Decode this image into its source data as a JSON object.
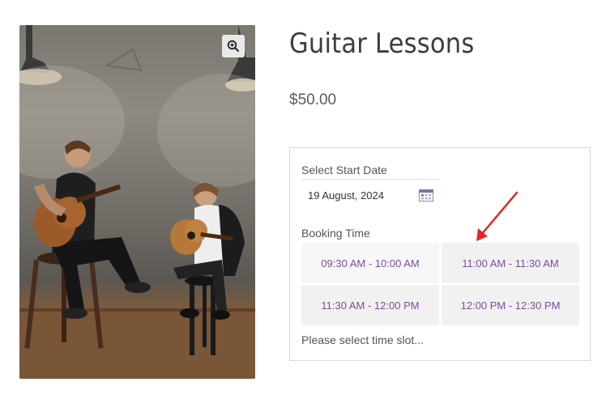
{
  "product": {
    "title": "Guitar Lessons",
    "price": "$50.00",
    "image_alt_icon": "zoom-in-icon"
  },
  "booking": {
    "start_date_label": "Select Start Date",
    "start_date_value": "19 August, 2024",
    "calendar_icon": "calendar-icon",
    "time_label": "Booking Time",
    "slots": [
      {
        "label": "09:30 AM - 10:00 AM"
      },
      {
        "label": "11:00 AM - 11:30 AM"
      },
      {
        "label": "11:30 AM - 12:00 PM"
      },
      {
        "label": "12:00 PM - 12:30 PM"
      }
    ],
    "help_text": "Please select time slot..."
  },
  "colors": {
    "slot_text": "#7a4f9a",
    "slot_bg": "#f1f1f1",
    "arrow": "#e8232a"
  }
}
